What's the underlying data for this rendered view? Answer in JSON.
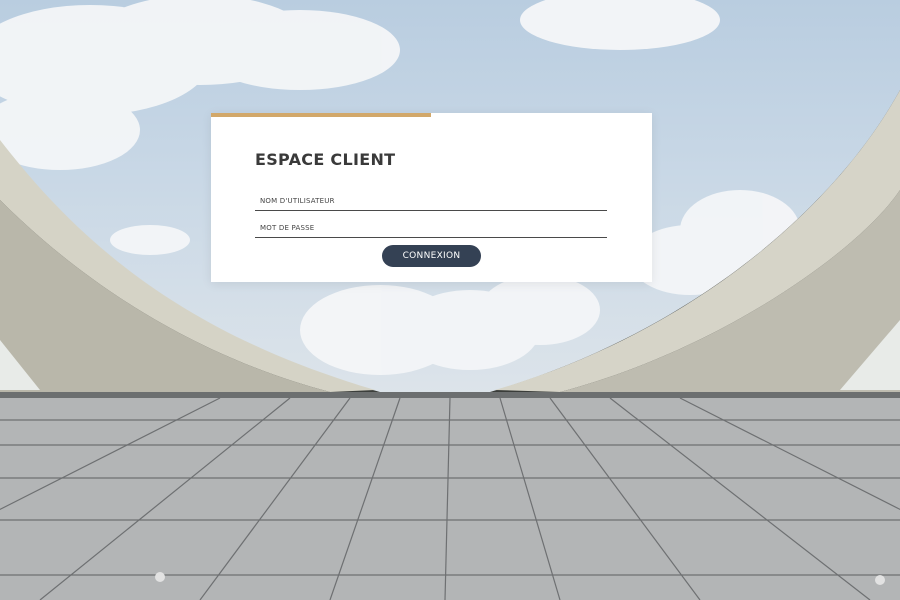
{
  "background": {
    "description_icon": "architecture-sky-photo"
  },
  "login": {
    "title": "ESPACE CLIENT",
    "username_placeholder": "NOM D'UTILISATEUR",
    "password_placeholder": "MOT DE PASSE",
    "submit_label": "CONNEXION"
  },
  "colors": {
    "accent": "#d2a86a",
    "button": "#344154",
    "card": "#ffffff"
  }
}
